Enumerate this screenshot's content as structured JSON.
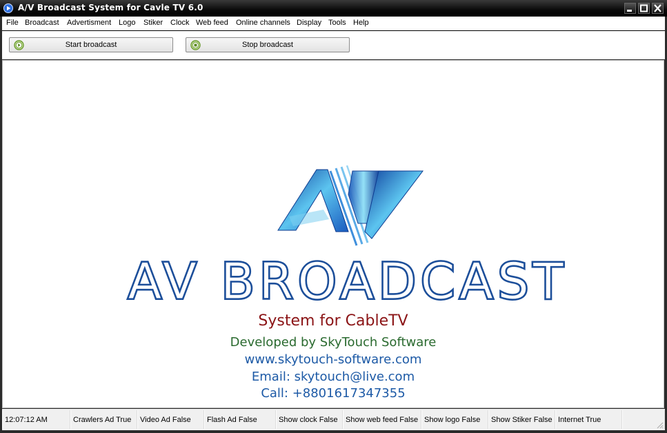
{
  "window": {
    "title": "A/V Broadcast System for Cavle TV 6.0"
  },
  "menu": [
    {
      "label": "File"
    },
    {
      "label": "Broadcast"
    },
    {
      "label": "Advertisment"
    },
    {
      "label": "Logo"
    },
    {
      "label": "Stiker"
    },
    {
      "label": "Clock"
    },
    {
      "label": "Web feed"
    },
    {
      "label": "Online channels"
    },
    {
      "label": "Display"
    },
    {
      "label": "Tools"
    },
    {
      "label": "Help"
    }
  ],
  "toolbar": {
    "start_label": "Start broadcast",
    "stop_label": "Stop broadcast"
  },
  "splash": {
    "logo_text": "AV",
    "headline": "AV BROADCAST",
    "tagline": "System for CableTV",
    "developer": "Developed by SkyTouch Software",
    "website": "www.skytouch-software.com",
    "email": "Email: skytouch@live.com",
    "phone": "Call: +8801617347355",
    "colors": {
      "headline": "#1d4f9a",
      "tagline": "#8b1416",
      "developer": "#2a6a2f",
      "contact": "#1d5aa6"
    }
  },
  "status": [
    {
      "label": "12:07:12 AM"
    },
    {
      "label": "Crawlers Ad True"
    },
    {
      "label": "Video Ad False"
    },
    {
      "label": "Flash Ad False"
    },
    {
      "label": "Show clock False"
    },
    {
      "label": "Show web feed False"
    },
    {
      "label": "Show logo False"
    },
    {
      "label": "Show Stiker False"
    },
    {
      "label": "Internet True"
    },
    {
      "label": ""
    }
  ]
}
